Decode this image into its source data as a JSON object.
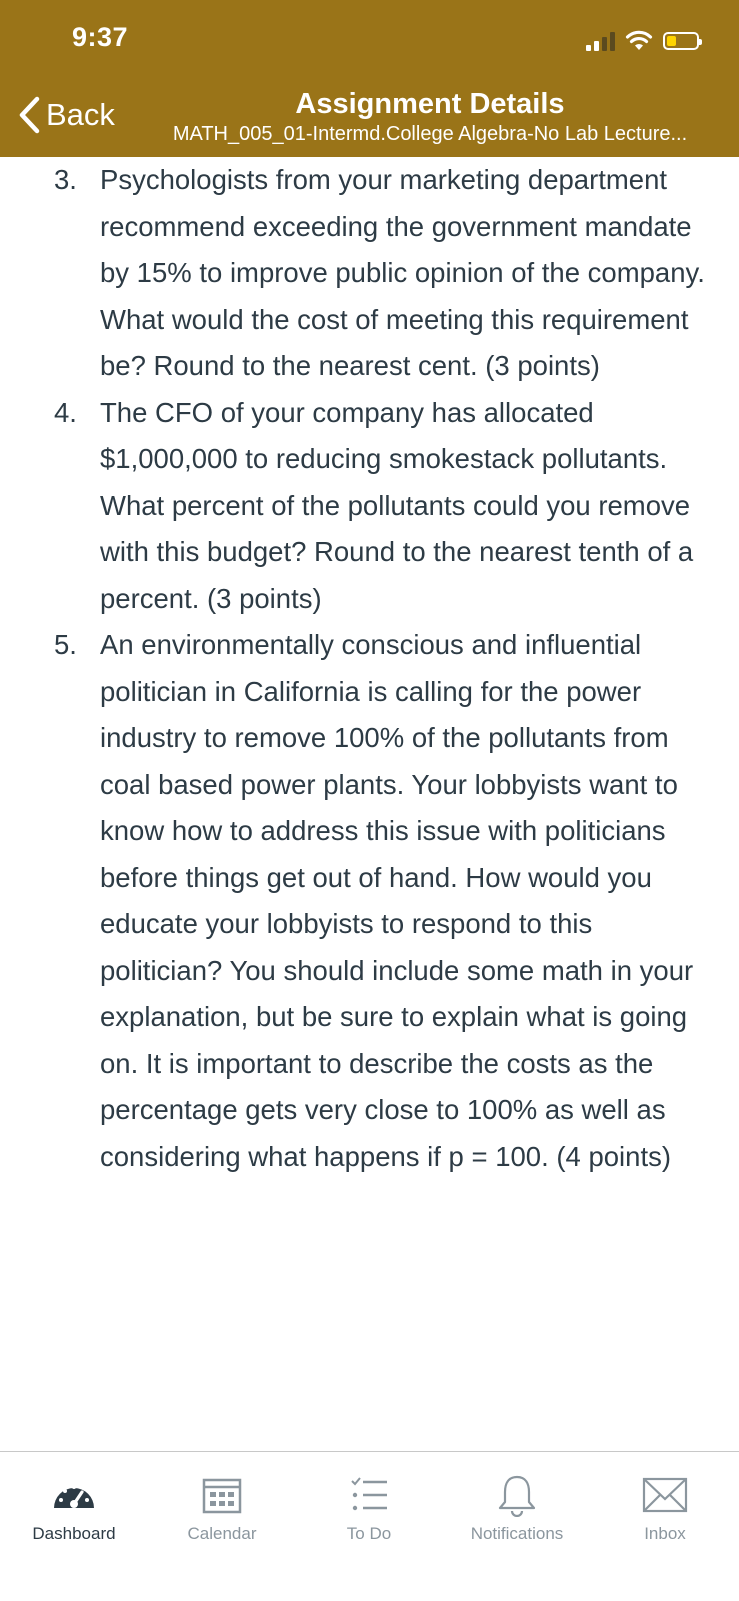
{
  "status_bar": {
    "time": "9:37"
  },
  "header": {
    "back_label": "Back",
    "title": "Assignment Details",
    "subtitle": "MATH_005_01-Intermd.College Algebra-No Lab Lecture..."
  },
  "questions": [
    {
      "number": "3.",
      "text": "Psychologists from your marketing department recommend exceeding the government mandate by 15% to improve public opinion of the company. What would the cost of meeting this requirement be?  Round to the nearest cent.  (3 points)"
    },
    {
      "number": "4.",
      "text": "The CFO of your company has allocated $1,000,000 to reducing smokestack pollutants. What percent of the pollutants could you remove with this budget?  Round to the nearest tenth of a percent.  (3 points)"
    },
    {
      "number": "5.",
      "text": "An environmentally conscious and influential politician in California is calling for the power industry to remove 100% of the pollutants from coal based power plants. Your lobbyists want to know how to address this issue with politicians before things get out of hand.  How would you educate your lobbyists to respond to this politician?  You should include some math in your explanation, but be sure to explain what is going on.  It is important to describe the costs as the percentage gets very close to 100% as well as considering what happens if p = 100. (4 points)"
    }
  ],
  "tab_bar": {
    "tabs": [
      {
        "label": "Dashboard",
        "icon": "dashboard-icon",
        "active": true
      },
      {
        "label": "Calendar",
        "icon": "calendar-icon"
      },
      {
        "label": "To Do",
        "icon": "todo-icon"
      },
      {
        "label": "Notifications",
        "icon": "bell-icon"
      },
      {
        "label": "Inbox",
        "icon": "inbox-icon"
      }
    ]
  },
  "colors": {
    "header_bg": "#9a7418",
    "text": "#2d3b45",
    "tab_inactive": "#8b969e"
  }
}
